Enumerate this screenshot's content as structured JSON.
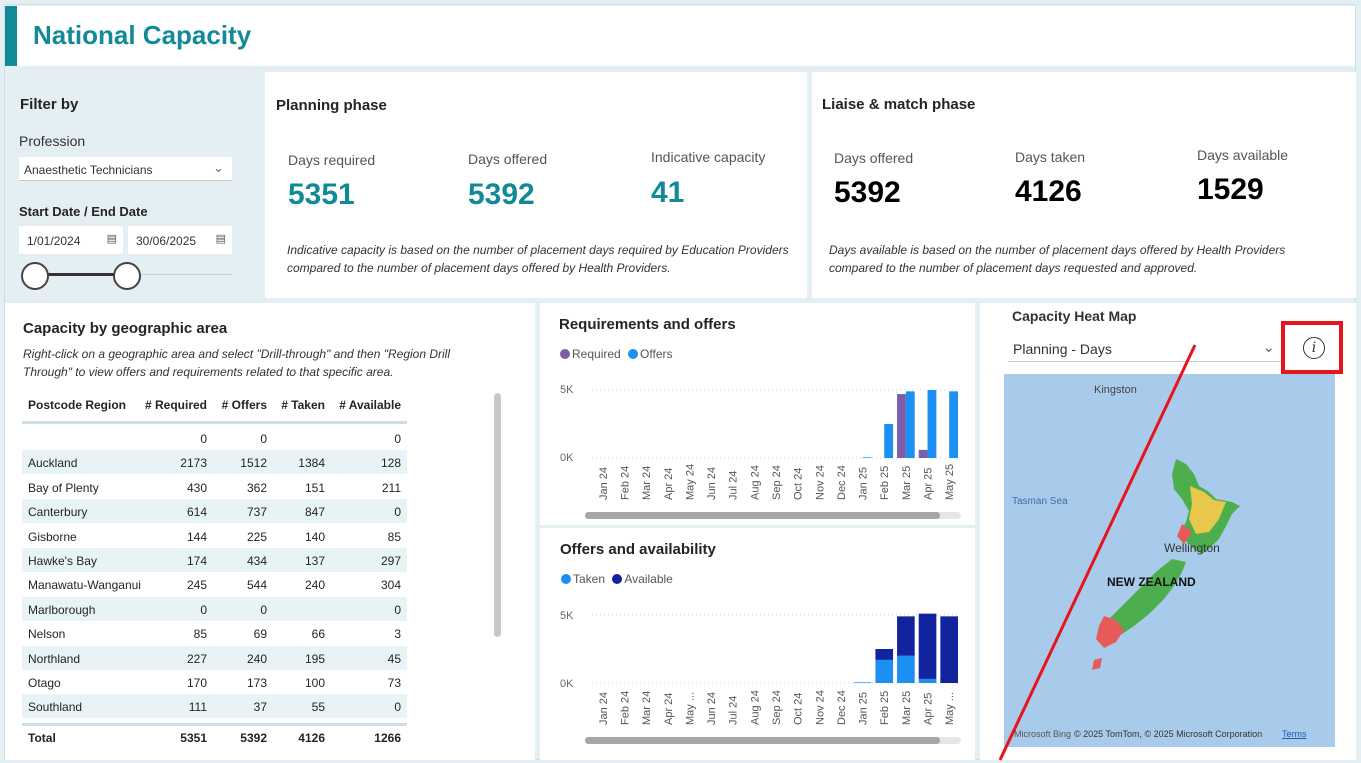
{
  "header": {
    "title": "National Capacity"
  },
  "filter": {
    "heading": "Filter by",
    "profession_label": "Profession",
    "profession_value": "Anaesthetic Technicians",
    "date_label": "Start Date / End Date",
    "start_date": "1/01/2024",
    "end_date": "30/06/2025"
  },
  "planning": {
    "title": "Planning phase",
    "kpis": [
      {
        "label": "Days required",
        "value": "5351"
      },
      {
        "label": "Days offered",
        "value": "5392"
      },
      {
        "label": "Indicative capacity",
        "value": "41"
      }
    ],
    "note": "Indicative capacity is based on the number of placement days required by Education Providers compared to the number of placement days offered by Health Providers.",
    "value_color": "#118a96"
  },
  "liaise": {
    "title": "Liaise & match phase",
    "kpis": [
      {
        "label": "Days offered",
        "value": "5392"
      },
      {
        "label": "Days taken",
        "value": "4126"
      },
      {
        "label": "Days available",
        "value": "1529"
      }
    ],
    "note": "Days available is based on the number of placement days offered by Health Providers compared to the number of placement days requested and approved."
  },
  "geo": {
    "title": "Capacity by geographic area",
    "subtitle": "Right-click on a geographic area and select \"Drill-through\" and then \"Region Drill Through\" to view offers and requirements related to that specific area.",
    "columns": [
      "Postcode Region",
      "# Required",
      "# Offers",
      "# Taken",
      "# Available"
    ],
    "rows": [
      [
        "",
        "0",
        "0",
        "",
        "0"
      ],
      [
        "Auckland",
        "2173",
        "1512",
        "1384",
        "128"
      ],
      [
        "Bay of Plenty",
        "430",
        "362",
        "151",
        "211"
      ],
      [
        "Canterbury",
        "614",
        "737",
        "847",
        "0"
      ],
      [
        "Gisborne",
        "144",
        "225",
        "140",
        "85"
      ],
      [
        "Hawke's Bay",
        "174",
        "434",
        "137",
        "297"
      ],
      [
        "Manawatu-Wanganui",
        "245",
        "544",
        "240",
        "304"
      ],
      [
        "Marlborough",
        "0",
        "0",
        "",
        "0"
      ],
      [
        "Nelson",
        "85",
        "69",
        "66",
        "3"
      ],
      [
        "Northland",
        "227",
        "240",
        "195",
        "45"
      ],
      [
        "Otago",
        "170",
        "173",
        "100",
        "73"
      ],
      [
        "Southland",
        "111",
        "37",
        "55",
        "0"
      ]
    ],
    "total": [
      "Total",
      "5351",
      "5392",
      "4126",
      "1266"
    ]
  },
  "charts": {
    "req_title": "Requirements and offers",
    "req_legend": [
      "Required",
      "Offers"
    ],
    "req_colors": [
      "#7b5ea7",
      "#1c8ff2"
    ],
    "off_title": "Offers and availability",
    "off_legend": [
      "Taken",
      "Available"
    ],
    "off_colors": [
      "#1c8ff2",
      "#12239e"
    ],
    "y_top": "5K",
    "y_zero": "0K"
  },
  "chart_data": [
    {
      "type": "bar",
      "title": "Requirements and offers",
      "categories": [
        "Jan 24",
        "Feb 24",
        "Mar 24",
        "Apr 24",
        "May 24",
        "Jun 24",
        "Jul 24",
        "Aug 24",
        "Sep 24",
        "Oct 24",
        "Nov 24",
        "Dec 24",
        "Jan 25",
        "Feb 25",
        "Mar 25",
        "Apr 25",
        "May 25"
      ],
      "series": [
        {
          "name": "Required",
          "values": [
            0,
            0,
            0,
            0,
            0,
            0,
            0,
            0,
            0,
            0,
            0,
            0,
            0,
            0,
            4700,
            600,
            0
          ]
        },
        {
          "name": "Offers",
          "values": [
            0,
            0,
            0,
            0,
            0,
            0,
            0,
            0,
            0,
            0,
            0,
            0,
            50,
            2500,
            4900,
            5000,
            4900
          ]
        }
      ],
      "ylim": [
        0,
        5000
      ]
    },
    {
      "type": "bar",
      "title": "Offers and availability",
      "stacked": true,
      "categories": [
        "Jan 24",
        "Feb 24",
        "Mar 24",
        "Apr 24",
        "May ...",
        "Jun 24",
        "Jul 24",
        "Aug 24",
        "Sep 24",
        "Oct 24",
        "Nov 24",
        "Dec 24",
        "Jan 25",
        "Feb 25",
        "Mar 25",
        "Apr 25",
        "May ..."
      ],
      "series": [
        {
          "name": "Taken",
          "values": [
            0,
            0,
            0,
            0,
            0,
            0,
            0,
            0,
            0,
            0,
            0,
            0,
            50,
            1700,
            2000,
            300,
            0
          ]
        },
        {
          "name": "Available",
          "values": [
            0,
            0,
            0,
            0,
            0,
            0,
            0,
            0,
            0,
            0,
            0,
            0,
            0,
            800,
            2900,
            4800,
            4900
          ]
        }
      ],
      "ylim": [
        0,
        5000
      ]
    }
  ],
  "map": {
    "title": "Capacity Heat Map",
    "dropdown_value": "Planning - Days",
    "labels": {
      "kingston": "Kingston",
      "tasman": "Tasman Sea",
      "wellington": "Wellington",
      "nz": "NEW ZEALAND"
    },
    "attribution": "© 2025 TomTom, © 2025 Microsoft Corporation",
    "terms": "Terms",
    "bing": "Microsoft Bing",
    "info_icon": "info-icon",
    "highlight_color": "#e8141c"
  }
}
